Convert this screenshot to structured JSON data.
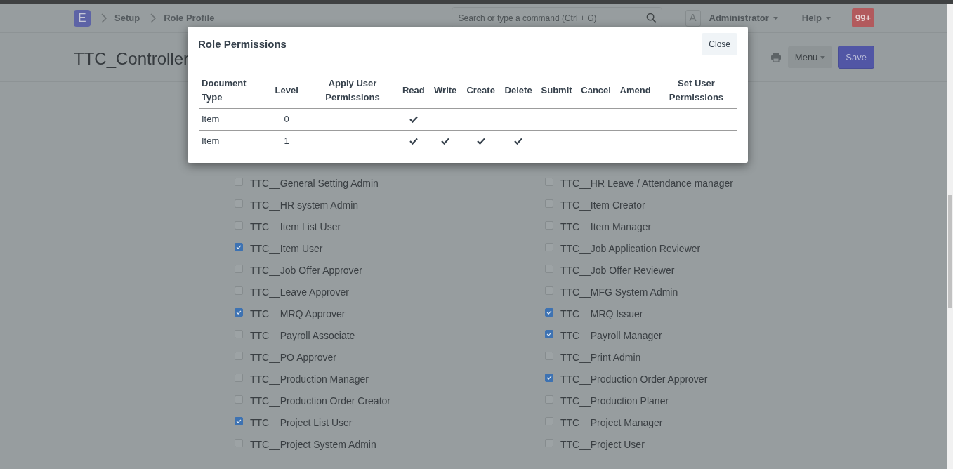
{
  "navbar": {
    "logo": "E",
    "breadcrumbs": [
      "Setup",
      "Role Profile"
    ],
    "search": {
      "placeholder": "Search or type a command (Ctrl + G)"
    },
    "avatar": "A",
    "user": "Administrator",
    "help": "Help",
    "notifications": "99+"
  },
  "page": {
    "title": "TTC_Controller",
    "buttons": [
      {
        "label": "Menu",
        "kind": "dropdown"
      },
      {
        "label": "Save",
        "kind": "primary"
      }
    ]
  },
  "roles": [
    {
      "label": "TTC__General Setting Admin",
      "checked": false
    },
    {
      "label": "TTC__HR Leave / Attendance manager",
      "checked": false
    },
    {
      "label": "TTC__HR system Admin",
      "checked": false
    },
    {
      "label": "TTC__Item Creator",
      "checked": false
    },
    {
      "label": "TTC__Item List User",
      "checked": false
    },
    {
      "label": "TTC__Item Manager",
      "checked": false
    },
    {
      "label": "TTC__Item User",
      "checked": true
    },
    {
      "label": "TTC__Job Application Reviewer",
      "checked": false
    },
    {
      "label": "TTC__Job Offer Approver",
      "checked": false
    },
    {
      "label": "TTC__Job Offer Reviewer",
      "checked": false
    },
    {
      "label": "TTC__Leave Approver",
      "checked": false
    },
    {
      "label": "TTC__MFG System Admin",
      "checked": false
    },
    {
      "label": "TTC__MRQ Approver",
      "checked": true
    },
    {
      "label": "TTC__MRQ Issuer",
      "checked": true
    },
    {
      "label": "TTC__Payroll Associate",
      "checked": false
    },
    {
      "label": "TTC__Payroll Manager",
      "checked": true
    },
    {
      "label": "TTC__PO Approver",
      "checked": false
    },
    {
      "label": "TTC__Print Admin",
      "checked": false
    },
    {
      "label": "TTC__Production Manager",
      "checked": false
    },
    {
      "label": "TTC__Production Order Approver",
      "checked": true
    },
    {
      "label": "TTC__Production Order Creator",
      "checked": false
    },
    {
      "label": "TTC__Production Planer",
      "checked": false
    },
    {
      "label": "TTC__Project List User",
      "checked": true
    },
    {
      "label": "TTC__Project Manager",
      "checked": false
    },
    {
      "label": "TTC__Project System Admin",
      "checked": false
    },
    {
      "label": "TTC__Project User",
      "checked": false
    }
  ],
  "modal": {
    "title": "Role Permissions",
    "close_button": "Close",
    "table": {
      "columns": [
        "Document Type",
        "Level",
        "Apply User Permissions",
        "Read",
        "Write",
        "Create",
        "Delete",
        "Submit",
        "Cancel",
        "Amend",
        "Set User Permissions"
      ],
      "rows": [
        {
          "document_type": "Item",
          "level": "0",
          "permissions": [
            false,
            true,
            false,
            false,
            false,
            false,
            false,
            false,
            false
          ]
        },
        {
          "document_type": "Item",
          "level": "1",
          "permissions": [
            false,
            true,
            true,
            true,
            true,
            false,
            false,
            false,
            false
          ]
        }
      ]
    }
  }
}
